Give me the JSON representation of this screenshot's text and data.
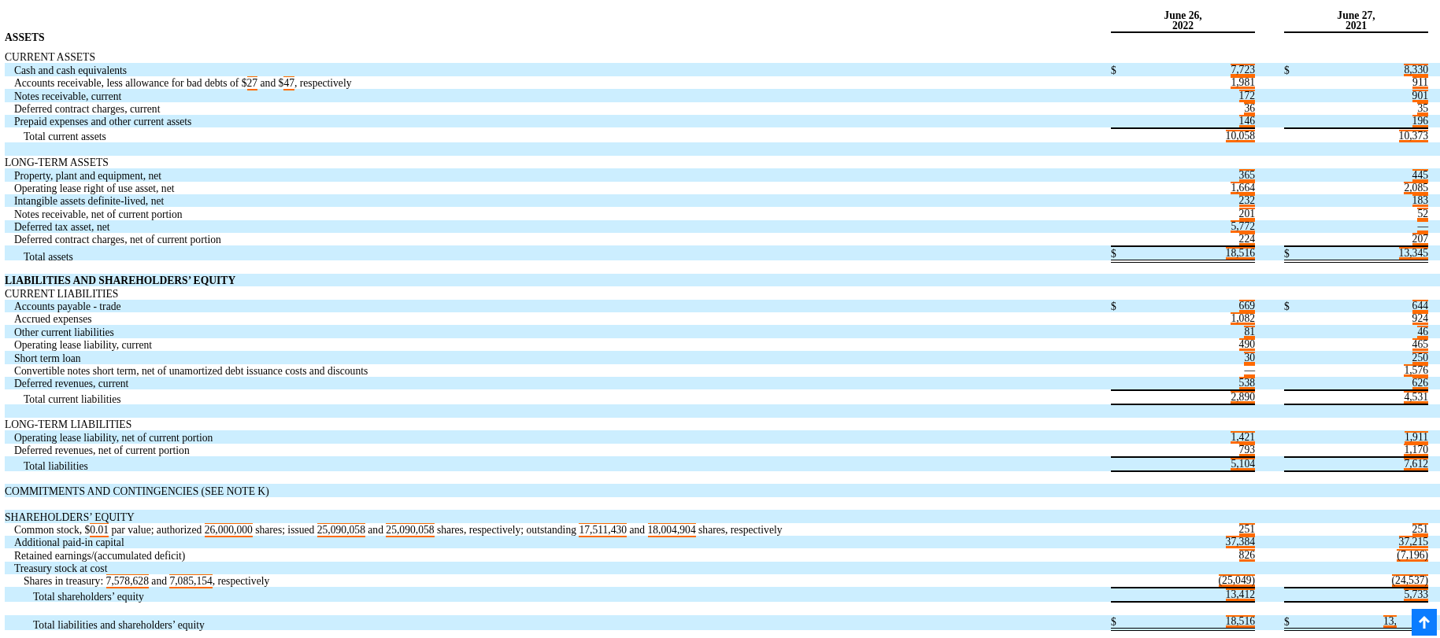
{
  "columns": [
    {
      "line1": "June 26,",
      "line2": "2022"
    },
    {
      "line1": "June 27,",
      "line2": "2021"
    }
  ],
  "heading": "ASSETS",
  "rows": [
    {
      "kind": "section",
      "label": "CURRENT ASSETS"
    },
    {
      "kind": "item",
      "label": "Cash and cash equivalents",
      "values": [
        {
          "currency": "$",
          "text": "7,723",
          "tagged": true
        },
        {
          "currency": "$",
          "text": "8,330",
          "tagged": true
        }
      ]
    },
    {
      "kind": "item",
      "segments": [
        {
          "text": "Accounts receivable, less allowance for bad debts of $",
          "tagged": false
        },
        {
          "text": "27",
          "tagged": true
        },
        {
          "text": " and $",
          "tagged": false
        },
        {
          "text": "47",
          "tagged": true
        },
        {
          "text": ", respectively",
          "tagged": false
        }
      ],
      "values": [
        {
          "text": "1,981",
          "tagged": true
        },
        {
          "text": "911",
          "tagged": true
        }
      ]
    },
    {
      "kind": "item",
      "label": "Notes receivable, current",
      "values": [
        {
          "text": "172",
          "tagged": true
        },
        {
          "text": "901",
          "tagged": true
        }
      ]
    },
    {
      "kind": "item",
      "label": "Deferred contract charges, current",
      "values": [
        {
          "text": "36",
          "tagged": true
        },
        {
          "text": "35",
          "tagged": true
        }
      ]
    },
    {
      "kind": "item",
      "label": "Prepaid expenses and other current assets",
      "values": [
        {
          "text": "146",
          "tagged": true
        },
        {
          "text": "196",
          "tagged": true
        }
      ]
    },
    {
      "kind": "total",
      "label": "Total current assets",
      "rule_above": true,
      "rule_below": false,
      "values": [
        {
          "text": "10,058",
          "tagged": true
        },
        {
          "text": "10,373",
          "tagged": true
        }
      ]
    },
    {
      "kind": "blank"
    },
    {
      "kind": "section",
      "label": "LONG-TERM ASSETS"
    },
    {
      "kind": "item",
      "label": "Property, plant and equipment, net",
      "values": [
        {
          "text": "365",
          "tagged": true
        },
        {
          "text": "445",
          "tagged": true
        }
      ]
    },
    {
      "kind": "item",
      "label": "Operating lease right of use asset, net",
      "values": [
        {
          "text": "1,664",
          "tagged": true
        },
        {
          "text": "2,085",
          "tagged": true
        }
      ]
    },
    {
      "kind": "item",
      "label": "Intangible assets definite-lived, net",
      "values": [
        {
          "text": "232",
          "tagged": true
        },
        {
          "text": "183",
          "tagged": true
        }
      ]
    },
    {
      "kind": "item",
      "label": "Notes receivable, net of current portion",
      "values": [
        {
          "text": "201",
          "tagged": true
        },
        {
          "text": "52",
          "tagged": true
        }
      ]
    },
    {
      "kind": "item",
      "label": "Deferred tax asset, net",
      "values": [
        {
          "text": "5,772",
          "tagged": true
        },
        {
          "text": "—",
          "tagged": true
        }
      ]
    },
    {
      "kind": "item",
      "label": "Deferred contract charges, net of current portion",
      "values": [
        {
          "text": "224",
          "tagged": true
        },
        {
          "text": "207",
          "tagged": true
        }
      ]
    },
    {
      "kind": "total",
      "label": "Total assets",
      "rule_above": true,
      "rule_below": true,
      "double_rule": true,
      "values": [
        {
          "currency": "$",
          "text": "18,516",
          "tagged": true
        },
        {
          "currency": "$",
          "text": "13,345",
          "tagged": true
        }
      ]
    },
    {
      "kind": "blank"
    },
    {
      "kind": "heading",
      "label": "LIABILITIES AND SHAREHOLDERS’ EQUITY"
    },
    {
      "kind": "section",
      "label": "CURRENT LIABILITIES"
    },
    {
      "kind": "item",
      "label": "Accounts payable - trade",
      "values": [
        {
          "currency": "$",
          "text": "669",
          "tagged": true
        },
        {
          "currency": "$",
          "text": "644",
          "tagged": true
        }
      ]
    },
    {
      "kind": "item",
      "label": "Accrued expenses",
      "values": [
        {
          "text": "1,082",
          "tagged": true
        },
        {
          "text": "924",
          "tagged": true
        }
      ]
    },
    {
      "kind": "item",
      "label": "Other current liabilities",
      "values": [
        {
          "text": "81",
          "tagged": true
        },
        {
          "text": "46",
          "tagged": true
        }
      ]
    },
    {
      "kind": "item",
      "label": "Operating lease liability, current",
      "values": [
        {
          "text": "490",
          "tagged": true
        },
        {
          "text": "465",
          "tagged": true
        }
      ]
    },
    {
      "kind": "item",
      "label": "Short term loan",
      "values": [
        {
          "text": "30",
          "tagged": true
        },
        {
          "text": "250",
          "tagged": true
        }
      ]
    },
    {
      "kind": "item",
      "label": "Convertible notes short term, net of unamortized debt issuance costs and discounts",
      "values": [
        {
          "text": "—",
          "tagged": true
        },
        {
          "text": "1,576",
          "tagged": true
        }
      ]
    },
    {
      "kind": "item",
      "label": "Deferred revenues, current",
      "values": [
        {
          "text": "538",
          "tagged": true
        },
        {
          "text": "626",
          "tagged": true
        }
      ]
    },
    {
      "kind": "total",
      "label": "Total current liabilities",
      "rule_above": true,
      "rule_below": true,
      "double_rule": false,
      "values": [
        {
          "text": "2,890",
          "tagged": true
        },
        {
          "text": "4,531",
          "tagged": true
        }
      ]
    },
    {
      "kind": "blank"
    },
    {
      "kind": "section",
      "label": "LONG-TERM LIABILITIES"
    },
    {
      "kind": "item",
      "label": "Operating lease liability, net of current portion",
      "values": [
        {
          "text": "1,421",
          "tagged": true
        },
        {
          "text": "1,911",
          "tagged": true
        }
      ]
    },
    {
      "kind": "item",
      "label": "Deferred revenues, net of current portion",
      "values": [
        {
          "text": "793",
          "tagged": true
        },
        {
          "text": "1,170",
          "tagged": true
        }
      ]
    },
    {
      "kind": "total",
      "label": "Total liabilities",
      "rule_above": true,
      "rule_below": true,
      "double_rule": false,
      "values": [
        {
          "text": "5,104",
          "tagged": true
        },
        {
          "text": "7,612",
          "tagged": true
        }
      ]
    },
    {
      "kind": "blank"
    },
    {
      "kind": "section",
      "label": "COMMITMENTS AND CONTINGENCIES (SEE NOTE K)"
    },
    {
      "kind": "blank"
    },
    {
      "kind": "section",
      "label": "SHAREHOLDERS’ EQUITY"
    },
    {
      "kind": "item",
      "segments": [
        {
          "text": "Common stock, $",
          "tagged": false
        },
        {
          "text": "0.01",
          "tagged": true
        },
        {
          "text": " par value; authorized ",
          "tagged": false
        },
        {
          "text": "26,000,000",
          "tagged": true
        },
        {
          "text": " shares; issued ",
          "tagged": false
        },
        {
          "text": "25,090,058",
          "tagged": true
        },
        {
          "text": " and ",
          "tagged": false
        },
        {
          "text": "25,090,058",
          "tagged": true
        },
        {
          "text": "  shares, respectively; outstanding ",
          "tagged": false
        },
        {
          "text": "17,511,430",
          "tagged": true
        },
        {
          "text": " and ",
          "tagged": false
        },
        {
          "text": "18,004,904",
          "tagged": true
        },
        {
          "text": " shares, respectively",
          "tagged": false
        }
      ],
      "values": [
        {
          "text": "251",
          "tagged": true
        },
        {
          "text": "251",
          "tagged": true
        }
      ]
    },
    {
      "kind": "item",
      "label": "Additional paid-in capital",
      "values": [
        {
          "text": "37,384",
          "tagged": true
        },
        {
          "text": "37,215",
          "tagged": true
        }
      ]
    },
    {
      "kind": "item",
      "label": "Retained earnings/(accumulated deficit)",
      "values": [
        {
          "text": "826",
          "tagged": true
        },
        {
          "text": "(7,196)",
          "tagged": true
        }
      ]
    },
    {
      "kind": "item",
      "label": "Treasury stock at cost"
    },
    {
      "kind": "subitem",
      "segments": [
        {
          "text": "Shares in treasury: ",
          "tagged": false
        },
        {
          "text": "7,578,628",
          "tagged": true
        },
        {
          "text": " and ",
          "tagged": false
        },
        {
          "text": "7,085,154",
          "tagged": true
        },
        {
          "text": ", respectively",
          "tagged": false
        }
      ],
      "values": [
        {
          "text": "(25,049)",
          "tagged": true
        },
        {
          "text": "(24,537)",
          "tagged": true
        }
      ]
    },
    {
      "kind": "grand_total",
      "label": "Total shareholders’ equity",
      "rule_above": true,
      "rule_below": true,
      "double_rule": false,
      "values": [
        {
          "text": "13,412",
          "tagged": true
        },
        {
          "text": "5,733",
          "tagged": true
        }
      ]
    },
    {
      "kind": "blank"
    },
    {
      "kind": "grand_total",
      "label": "Total liabilities and shareholders’ equity",
      "rule_above": false,
      "rule_below": true,
      "double_rule": true,
      "values": [
        {
          "currency": "$",
          "text": "18,516",
          "tagged": true
        },
        {
          "currency": "$",
          "text": "13,",
          "tagged": true
        }
      ]
    }
  ]
}
